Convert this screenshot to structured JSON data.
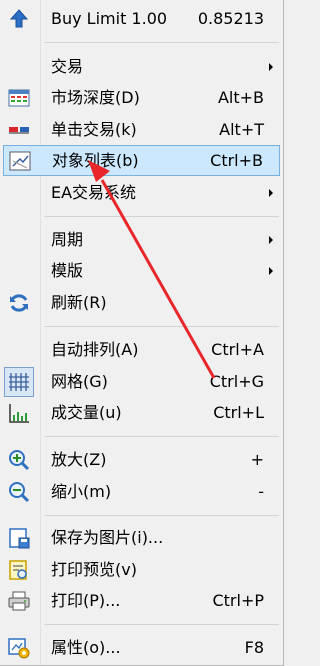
{
  "menu": {
    "buy_limit": {
      "label": "Buy Limit 1.00",
      "value": "0.85213",
      "icon": "up-arrow-icon"
    },
    "trading": {
      "label": "交易"
    },
    "market_depth": {
      "label": "市场深度(D)",
      "shortcut": "Alt+B",
      "icon": "depth-icon"
    },
    "one_click": {
      "label": "单击交易(k)",
      "shortcut": "Alt+T",
      "icon": "one-click-icon"
    },
    "object_list": {
      "label": "对象列表(b)",
      "shortcut": "Ctrl+B",
      "icon": "object-list-icon"
    },
    "ea_system": {
      "label": "EA交易系统"
    },
    "period": {
      "label": "周期"
    },
    "template": {
      "label": "模版"
    },
    "refresh": {
      "label": "刷新(R)",
      "icon": "refresh-icon"
    },
    "auto_scroll": {
      "label": "自动排列(A)",
      "shortcut": "Ctrl+A"
    },
    "grid": {
      "label": "网格(G)",
      "shortcut": "Ctrl+G",
      "icon": "grid-icon"
    },
    "volume": {
      "label": "成交量(u)",
      "shortcut": "Ctrl+L",
      "icon": "volume-icon"
    },
    "zoom_in": {
      "label": "放大(Z)",
      "shortcut": "+",
      "icon": "zoom-in-icon"
    },
    "zoom_out": {
      "label": "缩小(m)",
      "shortcut": "-",
      "icon": "zoom-out-icon"
    },
    "save_picture": {
      "label": "保存为图片(i)...",
      "icon": "save-picture-icon"
    },
    "print_preview": {
      "label": "打印预览(v)",
      "icon": "print-preview-icon"
    },
    "print": {
      "label": "打印(P)...",
      "shortcut": "Ctrl+P",
      "icon": "printer-icon"
    },
    "properties": {
      "label": "属性(o)...",
      "shortcut": "F8",
      "icon": "properties-icon"
    }
  },
  "colors": {
    "highlight": "#cce8ff",
    "highlight_border": "#7ab0dd",
    "annotation_arrow": "#e8262b"
  }
}
